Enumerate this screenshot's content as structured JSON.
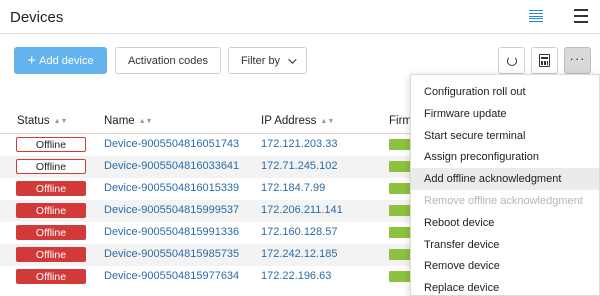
{
  "header": {
    "title": "Devices",
    "list_view_icon": "list-view-icon",
    "table_view_icon": "table-view-icon",
    "accent_color": "#2b86d6"
  },
  "toolbar": {
    "add_device": "Add device",
    "activation_codes": "Activation codes",
    "filter_by": "Filter by",
    "refresh_icon": "refresh-icon",
    "calculator_icon": "calculator-icon",
    "more_icon": "more-icon",
    "more_label": "···"
  },
  "table": {
    "columns": {
      "status": "Status",
      "name": "Name",
      "ip": "IP Address",
      "firmware": "Firm"
    },
    "rows": [
      {
        "status": "Offline",
        "style": "outline",
        "name": "Device-9005504816051743",
        "ip": "172.121.203.33"
      },
      {
        "status": "Offline",
        "style": "outline",
        "name": "Device-9005504816033641",
        "ip": "172.71.245.102"
      },
      {
        "status": "Offline",
        "style": "solid",
        "name": "Device-9005504816015339",
        "ip": "172.184.7.99"
      },
      {
        "status": "Offline",
        "style": "solid",
        "name": "Device-9005504815999537",
        "ip": "172.206.211.141"
      },
      {
        "status": "Offline",
        "style": "solid",
        "name": "Device-9005504815991336",
        "ip": "172.160.128.57"
      },
      {
        "status": "Offline",
        "style": "solid",
        "name": "Device-9005504815985735",
        "ip": "172.242.12.185"
      },
      {
        "status": "Offline",
        "style": "solid",
        "name": "Device-9005504815977634",
        "ip": "172.22.196.63"
      }
    ],
    "status_color": "#d23a3a",
    "firmware_color": "#8ec13f",
    "link_color": "#2a6ca8"
  },
  "menu": {
    "items": [
      {
        "label": "Configuration roll out",
        "state": "normal"
      },
      {
        "label": "Firmware update",
        "state": "normal"
      },
      {
        "label": "Start secure terminal",
        "state": "normal"
      },
      {
        "label": "Assign preconfiguration",
        "state": "normal"
      },
      {
        "label": "Add offline acknowledgment",
        "state": "hover"
      },
      {
        "label": "Remove offline acknowledgment",
        "state": "disabled"
      },
      {
        "label": "Reboot device",
        "state": "normal"
      },
      {
        "label": "Transfer device",
        "state": "normal"
      },
      {
        "label": "Remove device",
        "state": "normal"
      },
      {
        "label": "Replace device",
        "state": "normal"
      }
    ]
  }
}
